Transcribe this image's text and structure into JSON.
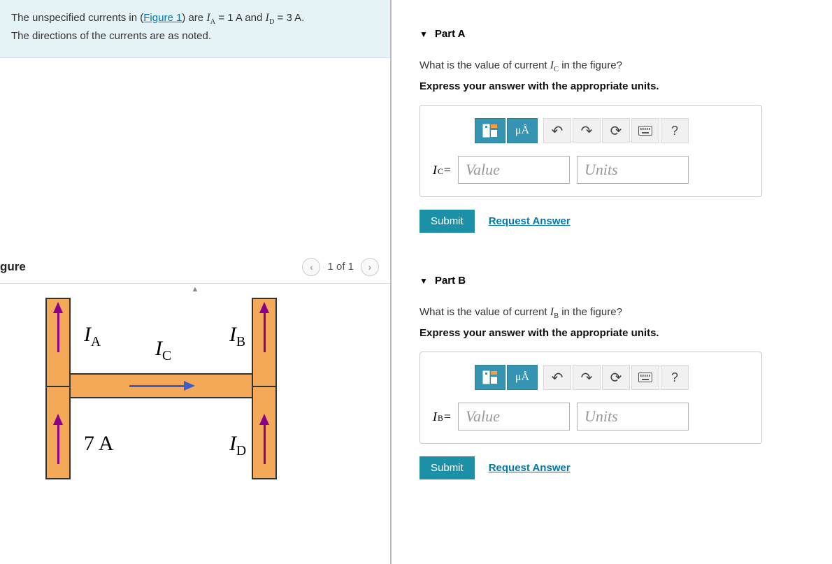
{
  "prompt": {
    "line1_prefix": "The unspecified currents in (",
    "figure_link": "Figure 1",
    "line1_mid": ") are ",
    "ia_expr": "IA",
    "ia_eq": " = 1 A",
    "and_text": " and ",
    "id_expr": "ID",
    "id_eq": " = 3 A.",
    "line2": "The directions of the currents are as noted."
  },
  "figure_panel": {
    "title": "gure",
    "nav_text": "1 of 1"
  },
  "figure_labels": {
    "ia": "IA",
    "ib": "IB",
    "ic": "IC",
    "id": "ID",
    "seven_a": "7 A"
  },
  "toolbar": {
    "units_icon": "μÅ",
    "help": "?",
    "undo": "↶",
    "redo": "↷",
    "reset": "⟳"
  },
  "part_a": {
    "title": "Part A",
    "question_prefix": "What is the value of current ",
    "question_var": "IC",
    "question_suffix": " in the figure?",
    "instruction": "Express your answer with the appropriate units.",
    "var_label": "IC",
    "equals": " = ",
    "value_ph": "Value",
    "units_ph": "Units"
  },
  "part_b": {
    "title": "Part B",
    "question_prefix": "What is the value of current ",
    "question_var": "IB",
    "question_suffix": " in the figure?",
    "instruction": "Express your answer with the appropriate units.",
    "var_label": "IB",
    "equals": " = ",
    "value_ph": "Value",
    "units_ph": "Units"
  },
  "actions": {
    "submit": "Submit",
    "request": "Request Answer"
  }
}
